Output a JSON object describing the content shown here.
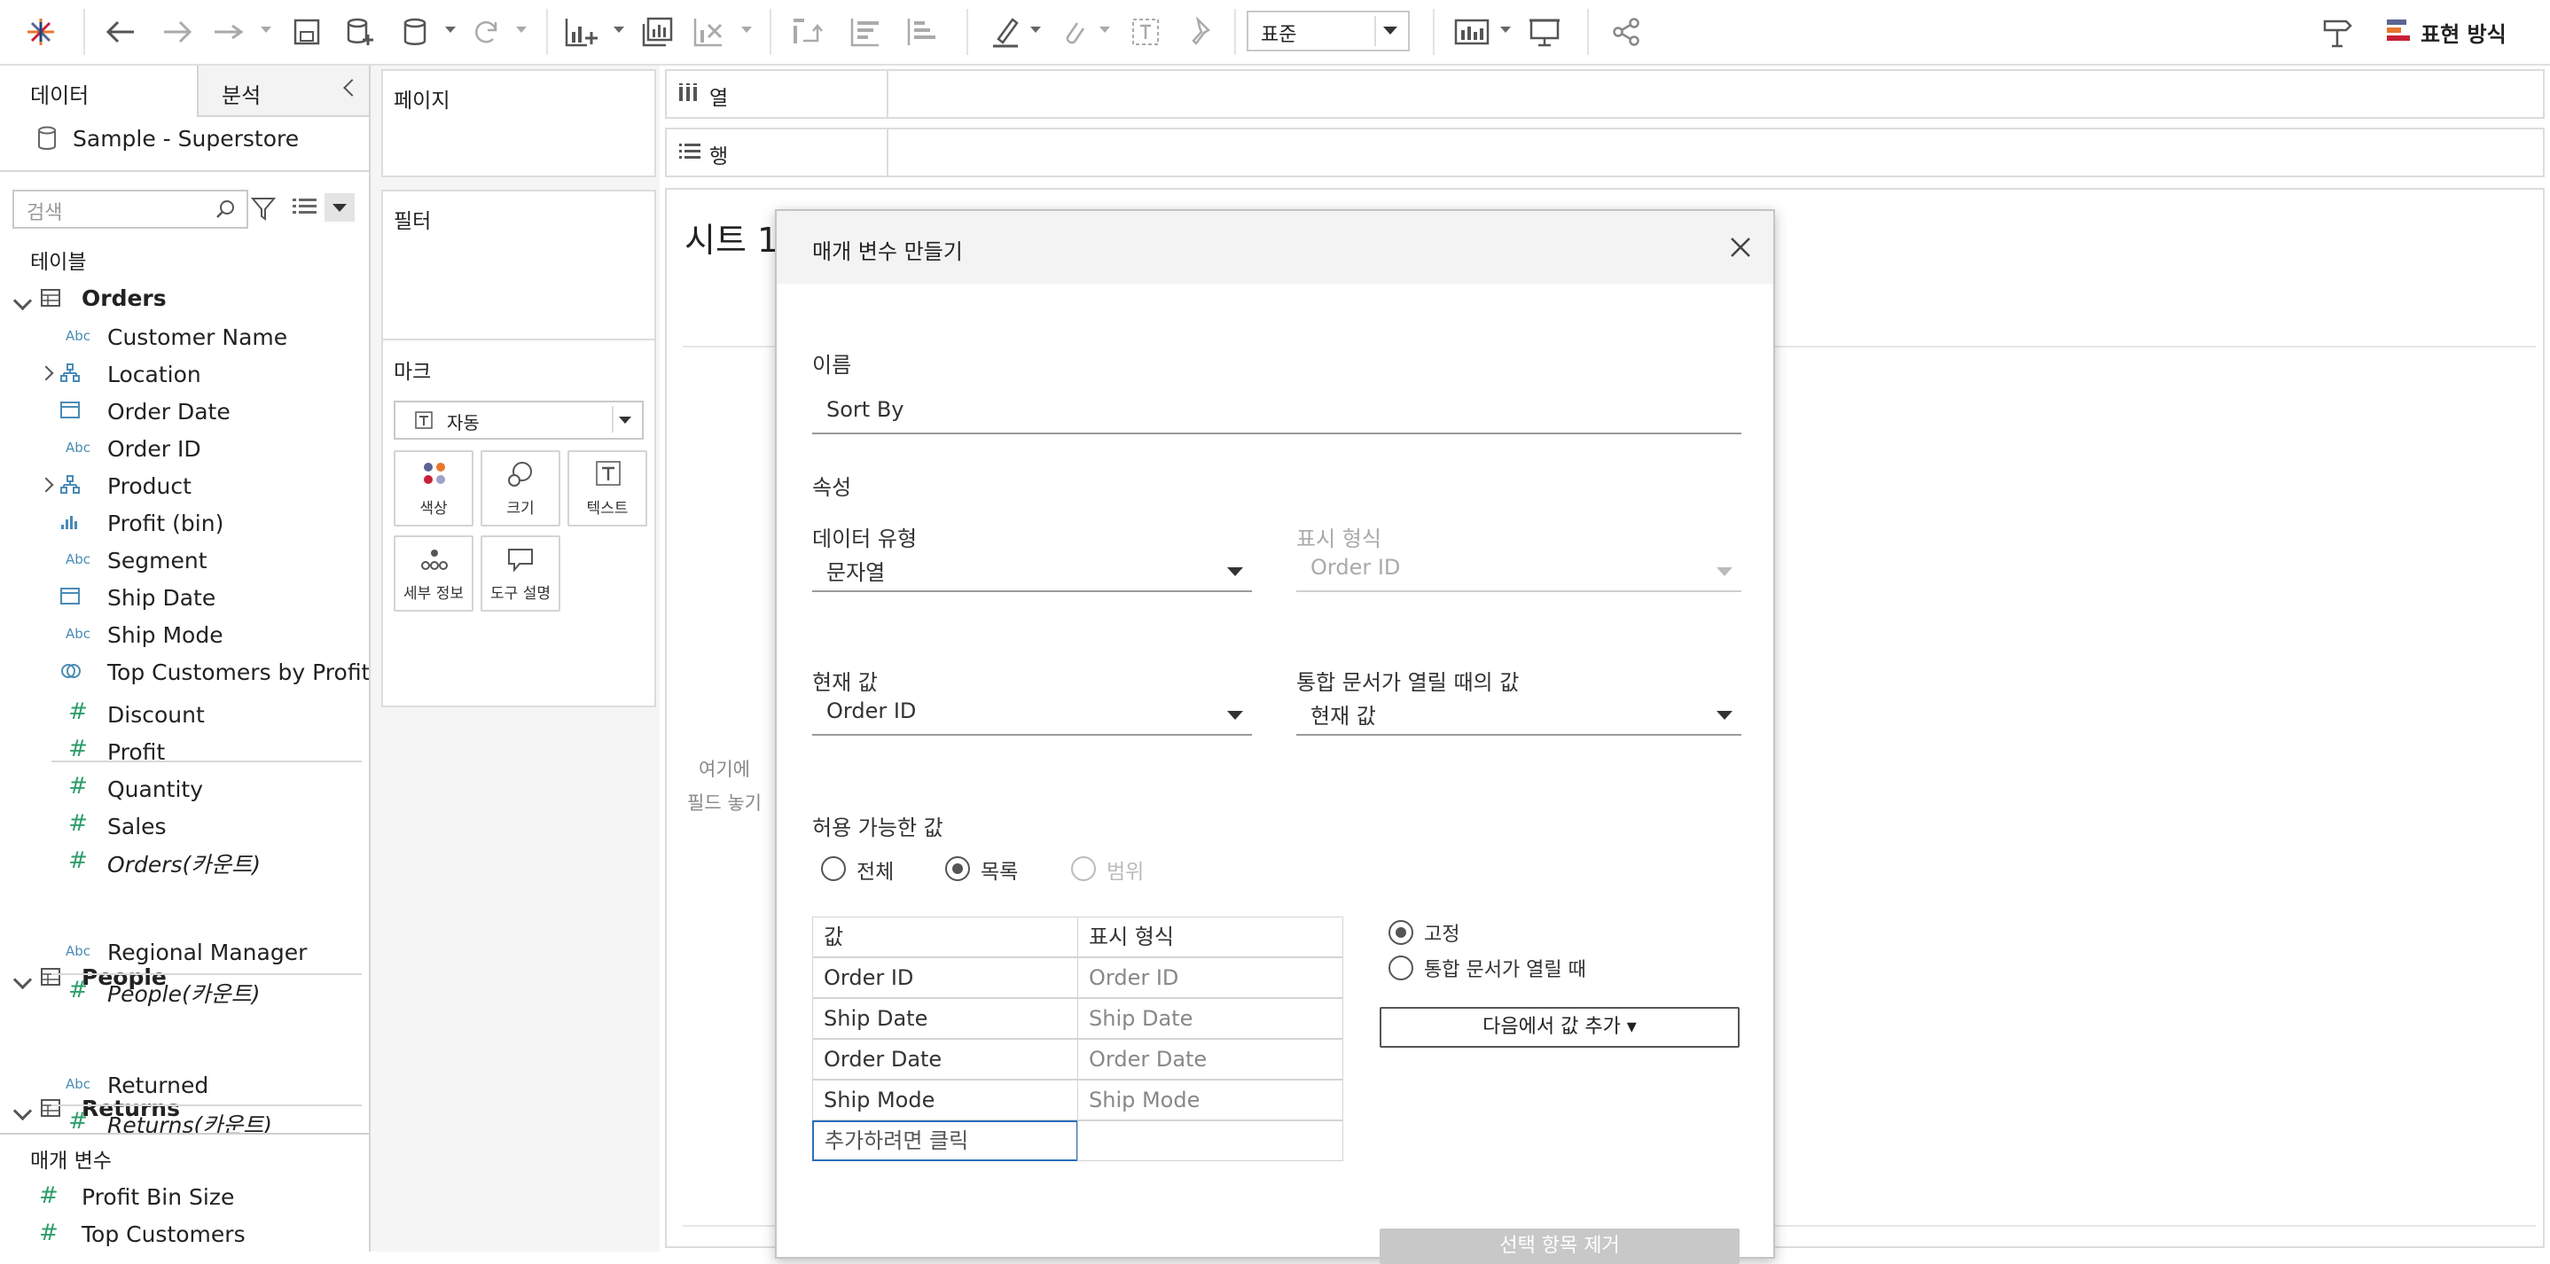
{
  "toolbar": {
    "format_value": "표준",
    "show_me_label": "표현 방식"
  },
  "side_panel": {
    "tab_data": "데이터",
    "tab_analysis": "분석",
    "datasource": "Sample - Superstore",
    "search_placeholder": "검색",
    "tables_header": "테이블",
    "orders": {
      "name": "Orders",
      "fields": [
        {
          "name": "Customer Name",
          "icon": "Abc"
        },
        {
          "name": "Location",
          "icon": "hierarchy"
        },
        {
          "name": "Order Date",
          "icon": "calendar"
        },
        {
          "name": "Order ID",
          "icon": "Abc"
        },
        {
          "name": "Product",
          "icon": "hierarchy"
        },
        {
          "name": "Profit (bin)",
          "icon": "bin"
        },
        {
          "name": "Segment",
          "icon": "Abc"
        },
        {
          "name": "Ship Date",
          "icon": "calendar"
        },
        {
          "name": "Ship Mode",
          "icon": "Abc"
        },
        {
          "name": "Top Customers by Profit",
          "icon": "set"
        }
      ],
      "measures": [
        "Discount",
        "Profit",
        "Quantity",
        "Sales",
        "Orders(카운트)"
      ]
    },
    "people": {
      "name": "People",
      "fields": [
        {
          "name": "Regional Manager",
          "icon": "Abc"
        }
      ],
      "measures": [
        "People(카운트)"
      ]
    },
    "returns": {
      "name": "Returns",
      "fields": [
        {
          "name": "Returned",
          "icon": "Abc"
        }
      ],
      "measures": [
        "Returns(카운트)"
      ]
    },
    "parameters_header": "매개 변수",
    "parameters": [
      "Profit Bin Size",
      "Top Customers"
    ]
  },
  "shelves": {
    "pages": "페이지",
    "filters": "필터",
    "marks": "마크",
    "mark_type": "자동",
    "mark_buttons": [
      "색상",
      "크기",
      "텍스트",
      "세부 정보",
      "도구 설명"
    ],
    "columns": "열",
    "rows": "행"
  },
  "sheet": {
    "title": "시트 1",
    "drop_field_line1": "여기에",
    "drop_field_line2": "필드 놓기"
  },
  "dialog": {
    "title": "매개 변수 만들기",
    "name_label": "이름",
    "name_value": "Sort By",
    "properties_label": "속성",
    "data_type_label": "데이터 유형",
    "data_type_value": "문자열",
    "display_format_label": "표시 형식",
    "display_format_value": "Order ID",
    "current_value_label": "현재 값",
    "current_value": "Order ID",
    "open_value_label": "통합 문서가 열릴 때의 값",
    "open_value": "현재 값",
    "allowable_label": "허용 가능한 값",
    "allowable_options": [
      "전체",
      "목록",
      "범위"
    ],
    "allowable_selected": "목록",
    "list_headers": [
      "값",
      "표시 형식"
    ],
    "list_rows": [
      {
        "value": "Order ID",
        "display": "Order ID"
      },
      {
        "value": "Ship Date",
        "display": "Ship Date"
      },
      {
        "value": "Order Date",
        "display": "Order Date"
      },
      {
        "value": "Ship Mode",
        "display": "Ship Mode"
      }
    ],
    "add_placeholder": "추가하려면 클릭",
    "fixed_label": "고정",
    "on_open_label": "통합 문서가 열릴 때",
    "add_from_label": "다음에서 값 추가 ▾",
    "remove_selected_label": "선택 항목 제거"
  },
  "colors": {
    "accent_blue": "#1f77b4",
    "field_icon_blue": "#4a8bb5",
    "measure_green": "#2e9e6a",
    "focus_blue": "#2a6ebb"
  }
}
